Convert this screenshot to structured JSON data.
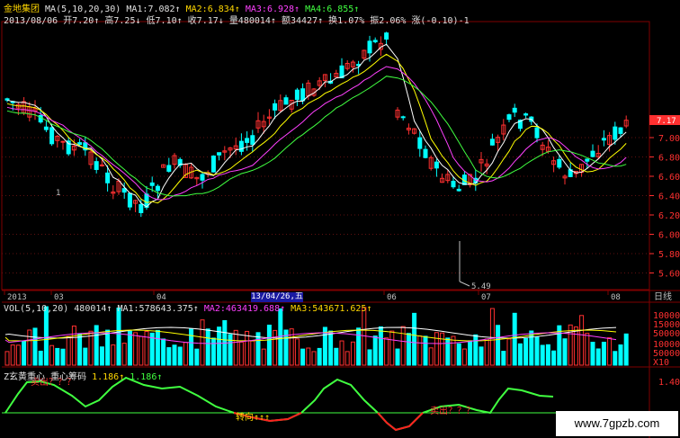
{
  "header": {
    "stock_name": "金地集团",
    "ma_label": "MA(5,10,20,30)",
    "ma1": "MA1:7.082↑",
    "ma2": "MA2:6.834↑",
    "ma3": "MA3:6.928↑",
    "ma4": "MA4:6.855↑",
    "date": "2013/08/06",
    "open": "开7.20↑",
    "high": "高7.25↓",
    "low": "低7.10↑",
    "close": "收7.17↓",
    "volume": "量480014↑",
    "amount": "额34427↑",
    "turnover": "换1.07%",
    "amplitude": "振2.06%",
    "change": "涨(-0.10)-1"
  },
  "price_axis": [
    "7.00",
    "6.80",
    "6.60",
    "6.40",
    "6.20",
    "6.00",
    "5.80",
    "5.60"
  ],
  "current_price_tag": "7.17",
  "min_price_label": "5.49",
  "low_marker": "1",
  "date_axis": [
    "2013",
    "03",
    "04",
    "06",
    "07",
    "08"
  ],
  "date_cursor": "13/04/26,五",
  "timeframe": "日线",
  "volume_header": {
    "label": "VOL(5,10,20)",
    "vol": "480014↑",
    "ma1": "MA1:578643.375↑",
    "ma2": "MA2:463419.688↑",
    "ma3": "MA3:543671.625↑"
  },
  "volume_axis": [
    "100000",
    "150000",
    "500000",
    "100000",
    "50000"
  ],
  "volume_unit": "X10",
  "indicator_header": {
    "label": "Z玄黄重心",
    "name": "重心筹码",
    "value1": "1.186↑",
    "value2": "1.186↑"
  },
  "indicator_axis": [
    "1.40"
  ],
  "indicator_sell_signal": "卖出？？？",
  "indicator_turn_signal": "转向↑↑↑",
  "indicator_sell_signal_2": "卖出？？？",
  "watermark": "www.7gpzb.com",
  "colors": {
    "up": "#ff3030",
    "down": "#00ffff",
    "ma1": "#ffffff",
    "ma2": "#ffff00",
    "ma3": "#ff40ff",
    "ma4": "#40ff40",
    "grid": "#800000"
  }
}
